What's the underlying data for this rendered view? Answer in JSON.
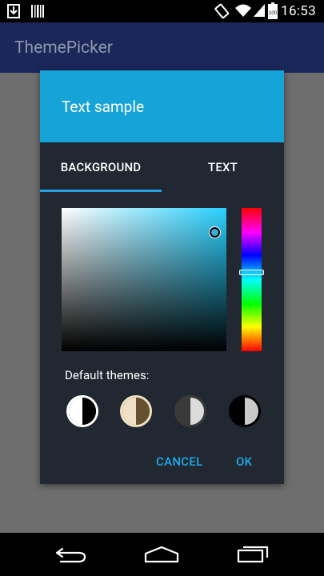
{
  "status_bar": {
    "time": "16:53",
    "battery_percent": 100,
    "icons": [
      "download-icon",
      "barcode-icon",
      "screen-rotation-icon",
      "wifi-icon",
      "signal-icon",
      "battery-icon"
    ]
  },
  "app_bar": {
    "title": "ThemePicker"
  },
  "dialog": {
    "title": "Text sample",
    "tabs": [
      {
        "label": "BACKGROUND",
        "selected": true
      },
      {
        "label": "TEXT",
        "selected": false
      }
    ],
    "color_picker": {
      "hue_color": "#28d0ff",
      "selected_color": "#3ab0d8"
    },
    "default_themes_label": "Default themes:",
    "themes": [
      {
        "name": "white-black",
        "left": "#ffffff",
        "right": "#000000"
      },
      {
        "name": "beige-brown",
        "left": "#f1e1c4",
        "right": "#65512f"
      },
      {
        "name": "dark-gray-light",
        "left": "#3a3a3a",
        "right": "#dcdcdc"
      },
      {
        "name": "black-gray",
        "left": "#000000",
        "right": "#c8c8c8"
      }
    ],
    "buttons": {
      "cancel": "CANCEL",
      "ok": "OK"
    }
  },
  "colors": {
    "app_bar": "#1b2759",
    "dialog_header": "#16a3d8",
    "dialog_body": "#212832",
    "accent": "#26a3e2",
    "button_text": "#1ca9ea"
  },
  "nav_bar": {
    "icons": [
      "back-icon",
      "home-icon",
      "recents-icon"
    ]
  }
}
